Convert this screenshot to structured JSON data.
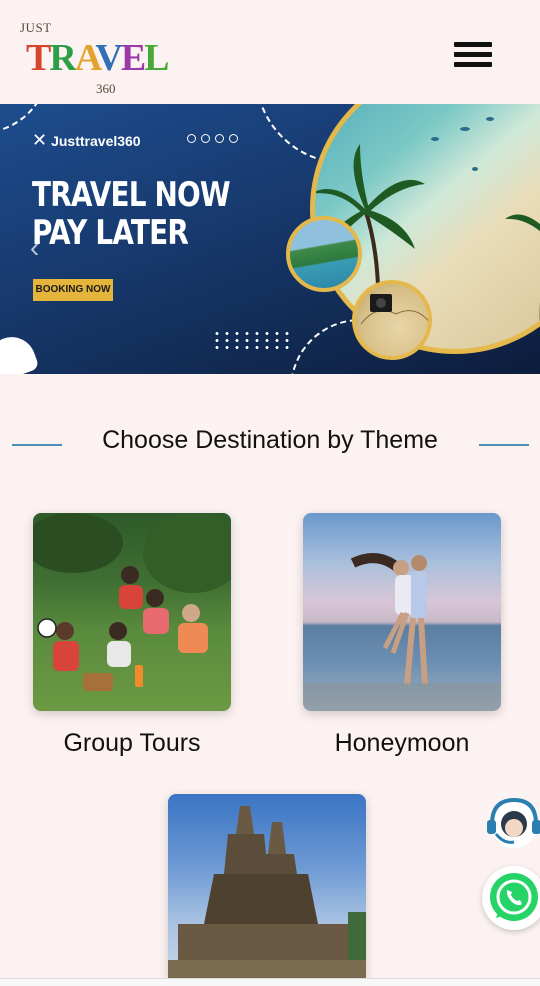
{
  "header": {
    "logo_top": "JUST",
    "logo_main": [
      "T",
      "R",
      "A",
      "V",
      "E",
      "L"
    ],
    "logo_bottom": "360"
  },
  "banner": {
    "brand": "Justtravel360",
    "headline_line1": "TRAVEL NOW",
    "headline_line2": "PAY LATER",
    "cta": "BOOKING NOW",
    "prev": "‹"
  },
  "section": {
    "title": "Choose Destination by Theme"
  },
  "themes": [
    {
      "label": "Group Tours"
    },
    {
      "label": "Honeymoon"
    },
    {
      "label": ""
    }
  ],
  "colors": {
    "page_bg": "#fcf2f2",
    "banner_blue": "#17386b",
    "gold": "#e5b53b",
    "whatsapp": "#25d366",
    "support": "#2a7fb0"
  }
}
